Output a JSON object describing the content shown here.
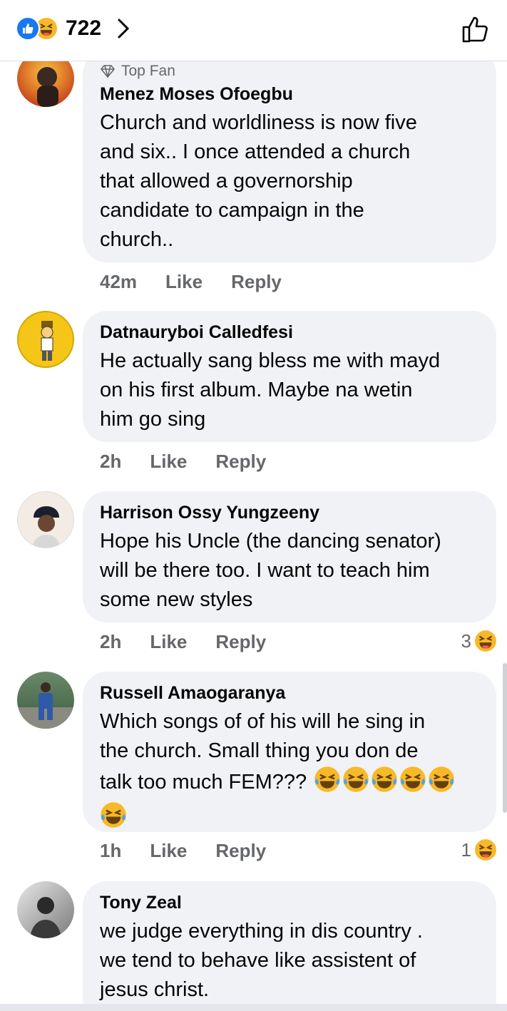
{
  "header": {
    "reaction_count": "722",
    "reaction_icons": [
      "like-icon",
      "haha-icon"
    ],
    "accent_color": "#1877f2",
    "haha_color": "#f7b928"
  },
  "comments": [
    {
      "badge": "Top Fan",
      "name": "Menez Moses Ofoegbu",
      "lines": [
        "Church and worldliness is now five",
        "and six.. I once attended a church",
        "that allowed a governorship",
        "candidate to campaign in the",
        "church.."
      ],
      "time": "42m",
      "like": "Like",
      "reply": "Reply"
    },
    {
      "name": "Datnauryboi Calledfesi",
      "lines": [
        "He actually sang bless me with mayd",
        "on his first album. Maybe na wetin",
        "him go sing"
      ],
      "time": "2h",
      "like": "Like",
      "reply": "Reply"
    },
    {
      "name": "Harrison Ossy Yungzeeny",
      "lines": [
        "Hope his Uncle (the dancing senator)",
        "will be there too. I want to teach him",
        "some new styles"
      ],
      "time": "2h",
      "like": "Like",
      "reply": "Reply",
      "reaction_count": "3"
    },
    {
      "name": "Russell Amaogaranya",
      "lines": [
        "Which songs of of his will he sing in",
        "the church. Small thing you don de",
        "talk too much FEM???"
      ],
      "emoji_count_line3": 5,
      "emoji_count_line4": 1,
      "time": "1h",
      "like": "Like",
      "reply": "Reply",
      "reaction_count": "1"
    },
    {
      "name": "Tony Zeal",
      "lines": [
        "we judge everything in dis country .",
        "we tend to behave like assistent of",
        "jesus christ."
      ]
    }
  ]
}
